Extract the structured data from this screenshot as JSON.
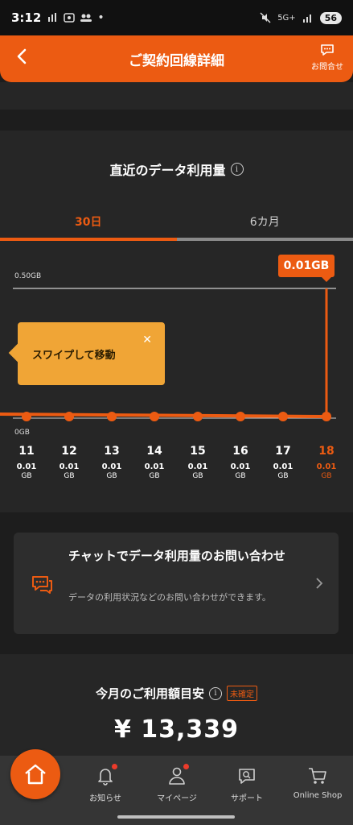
{
  "status_bar": {
    "time": "3:12",
    "network": "5G+",
    "battery": "56"
  },
  "header": {
    "title": "ご契約回線詳細",
    "inquiry_label": "お問合せ"
  },
  "usage": {
    "title": "直近のデータ利用量",
    "tabs": [
      {
        "label": "30日",
        "active": true
      },
      {
        "label": "6カ月",
        "active": false
      }
    ],
    "selected_value": "0.01GB",
    "tooltip": "スワイプして移動",
    "axis_top_label": "0.50GB",
    "axis_zero_label": "0GB",
    "days": [
      {
        "day": "11",
        "value": "0.01",
        "unit": "GB"
      },
      {
        "day": "12",
        "value": "0.01",
        "unit": "GB"
      },
      {
        "day": "13",
        "value": "0.01",
        "unit": "GB"
      },
      {
        "day": "14",
        "value": "0.01",
        "unit": "GB"
      },
      {
        "day": "15",
        "value": "0.01",
        "unit": "GB"
      },
      {
        "day": "16",
        "value": "0.01",
        "unit": "GB"
      },
      {
        "day": "17",
        "value": "0.01",
        "unit": "GB"
      },
      {
        "day": "18",
        "value": "0.01",
        "unit": "GB"
      }
    ],
    "selected_day": "18"
  },
  "chat_card": {
    "title": "チャットでデータ利用量のお問い合わせ",
    "description": "データの利用状況などのお問い合わせができます。"
  },
  "billing": {
    "title": "今月のご利用額目安",
    "badge": "未確定",
    "amount": "¥ 13,339"
  },
  "bottom_nav": {
    "items": [
      {
        "label": "お知らせ",
        "icon": "bell-icon",
        "has_dot": true
      },
      {
        "label": "マイページ",
        "icon": "person-icon",
        "has_dot": true
      },
      {
        "label": "サポート",
        "icon": "support-icon",
        "has_dot": false
      },
      {
        "label": "Online Shop",
        "icon": "cart-icon",
        "has_dot": false
      }
    ]
  },
  "colors": {
    "accent": "#ec5b12",
    "tooltip": "#f0a536",
    "background": "#1d1d1d"
  }
}
